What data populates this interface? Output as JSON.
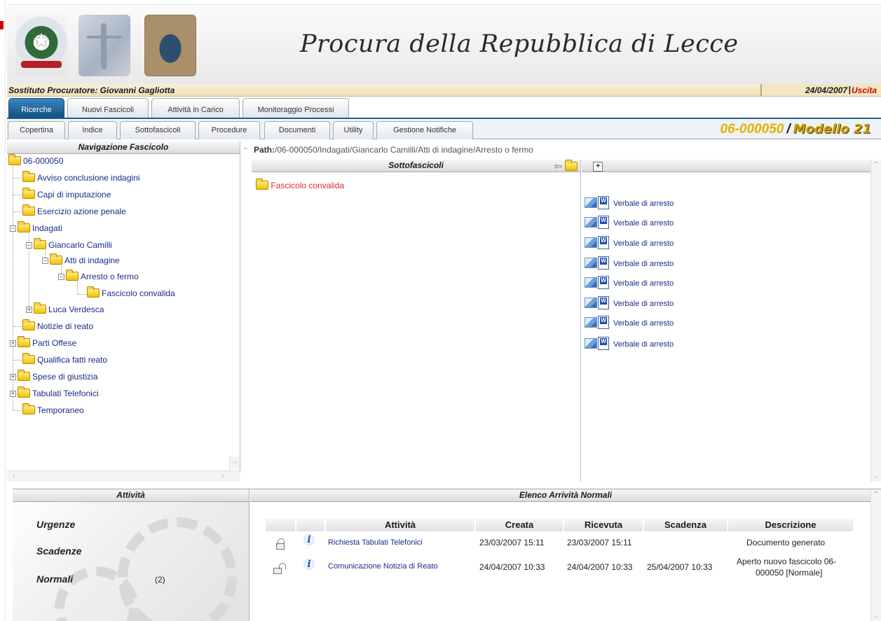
{
  "header": {
    "title": "Procura della Repubblica di Lecce",
    "emblems": [
      "state-emblem-icon",
      "justice-icon",
      "seal-icon"
    ]
  },
  "userbar": {
    "user": "Sostituto Procuratore: Giovanni Gagliotta",
    "date": "24/04/2007",
    "separator": "|",
    "exit": "Uscita"
  },
  "main_tabs": [
    "Ricerche",
    "Nuovi Fascicoli",
    "Attività in Carico",
    "Monitoraggio Processi"
  ],
  "active_main_tab": "Ricerche",
  "sub_tabs": [
    "Copertina",
    "Indice",
    "Sottofascicoli",
    "Procedure",
    "Documenti",
    "Utility",
    "Gestione Notifiche"
  ],
  "case": {
    "number": "06-000050",
    "separator": "/",
    "model": "Modello 21"
  },
  "navigation": {
    "title": "Navigazione Fascicolo",
    "tree": [
      {
        "label": "06-000050"
      },
      {
        "label": "Avviso conclusione indagini"
      },
      {
        "label": "Capi di imputazione"
      },
      {
        "label": "Esercizio azione penale"
      },
      {
        "label": "Indagati"
      },
      {
        "label": "Giancarlo Camilli"
      },
      {
        "label": "Atti di indagine"
      },
      {
        "label": "Arresto o fermo"
      },
      {
        "label": "Fascicolo convalida"
      },
      {
        "label": "Luca Verdesca"
      },
      {
        "label": "Notizie di reato"
      },
      {
        "label": "Parti Offese"
      },
      {
        "label": "Qualifica fatti reato"
      },
      {
        "label": "Spese di giustizia"
      },
      {
        "label": "Tabulati Telefonici"
      },
      {
        "label": "Temporaneo"
      }
    ]
  },
  "path": {
    "prefix": "Path:",
    "value": "/06-000050/Indagati/Giancarlo Camilli/Atti di indagine/Arresto o fermo"
  },
  "subfolders": {
    "title": "Sottofascicoli",
    "items": [
      "Fascicolo convalida"
    ]
  },
  "documents": {
    "items": [
      "Verbale di arresto",
      "Verbale di arresto",
      "Verbale di arresto",
      "Verbale di arresto",
      "Verbale di arresto",
      "Verbale di arresto",
      "Verbale di arresto",
      "Verbale di arresto"
    ]
  },
  "activity": {
    "title": "Attività",
    "urgent": "Urgenze",
    "deadlines": "Scadenze",
    "normal": "Normali",
    "normal_count": "(2)"
  },
  "arrivals": {
    "title": "Elenco Arrività Normali",
    "columns": [
      "Attività",
      "Creata",
      "Ricevuta",
      "Scadenza",
      "Descrizione"
    ],
    "rows": [
      {
        "activity": "Richiesta Tabulati Telefonici",
        "created": "23/03/2007 15:11",
        "received": "23/03/2007 15:11",
        "deadline": "",
        "description": "Documento generato",
        "lock": "closed"
      },
      {
        "activity": "Comunicazione Notizia di Reato",
        "created": "24/04/2007 10:33",
        "received": "24/04/2007 10:33",
        "deadline": "25/04/2007 10:33",
        "description_line1": "Aperto nuovo fascicolo 06-",
        "description_line2": "000050 [Normale]",
        "lock": "open"
      }
    ]
  },
  "colors": {
    "accent_blue": "#13507f",
    "link_blue": "#1b2a8a",
    "case_gold": "#e2b200",
    "exit_red": "#d40000",
    "subfolder_red": "#e3262e"
  }
}
